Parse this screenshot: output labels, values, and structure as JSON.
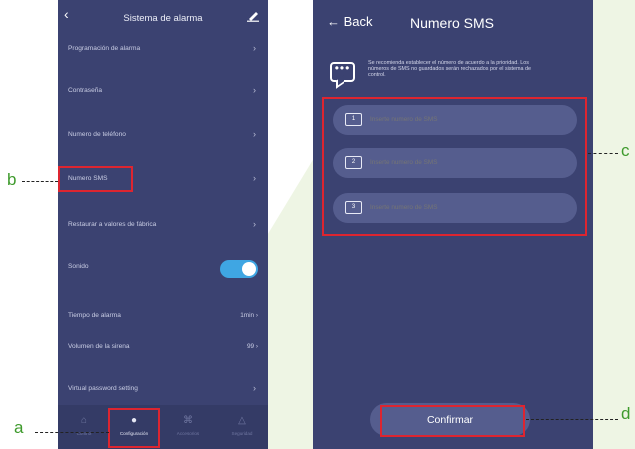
{
  "left_phone": {
    "title": "Sistema de alarma",
    "rows": [
      {
        "label": "Programación de alarma",
        "sub": "",
        "trailing": "›"
      },
      {
        "label": "Contraseña",
        "trailing": "›"
      },
      {
        "label": "Numero de teléfono",
        "trailing": "›"
      },
      {
        "label": "Numero SMS",
        "trailing": "›"
      },
      {
        "label": "Restaurar a valores de fábrica",
        "trailing": "›"
      },
      {
        "label": "Sonido",
        "toggle_on": true
      },
      {
        "label": "Tiempo de alarma",
        "value": "1min ›"
      },
      {
        "label": "Volumen de la sirena",
        "value": "99 ›"
      },
      {
        "label": "Virtual password setting",
        "trailing": "›"
      }
    ],
    "tabs": [
      {
        "label": "Control",
        "icon": "home-icon"
      },
      {
        "label": "Configuración",
        "icon": "gear-icon",
        "active": true
      },
      {
        "label": "Accesorios",
        "icon": "accessories-icon"
      },
      {
        "label": "Seguridad",
        "icon": "warning-icon"
      }
    ]
  },
  "right_phone": {
    "back_label": "← Back",
    "title": "Numero SMS",
    "info_text": "Se recomienda establecer el número de acuerdo a la prioridad. Los\nnúmeros de SMS no guardados serán rechazados por el sistema de\ncontrol.",
    "fields": [
      {
        "index": "1",
        "placeholder": "Inserte numero de SMS"
      },
      {
        "index": "2",
        "placeholder": "Inserte numero de SMS"
      },
      {
        "index": "3",
        "placeholder": "Inserte numero de SMS"
      }
    ],
    "confirm_label": "Confirmar"
  },
  "annotations": {
    "a": "a",
    "b": "b",
    "c": "c",
    "d": "d",
    "highlight_color": "#dd2530",
    "callout_color": "#3e9a2c"
  }
}
